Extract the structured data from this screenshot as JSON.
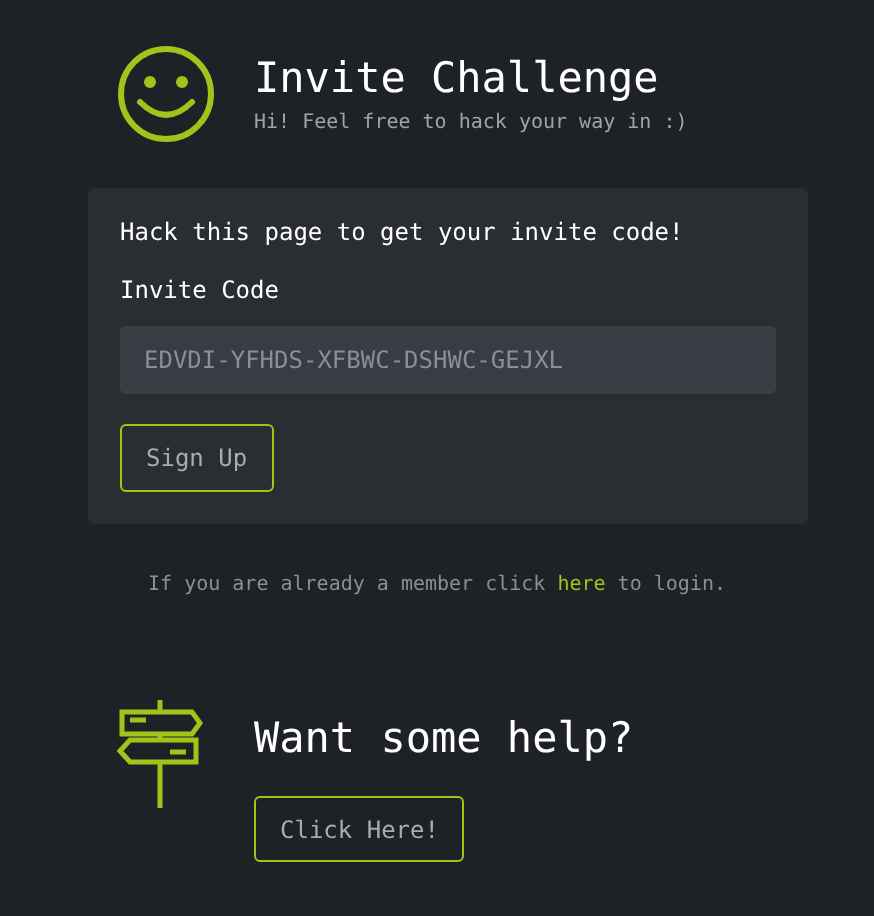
{
  "header": {
    "title": "Invite Challenge",
    "subtitle": "Hi! Feel free to hack your way in :)"
  },
  "card": {
    "heading": "Hack this page to get your invite code!",
    "field_label": "Invite Code",
    "field": {
      "placeholder": "EDVDI-YFHDS-XFBWC-DSHWC-GEJXL"
    },
    "button": "Sign Up"
  },
  "login_note": {
    "before": "If you are already a member click",
    "link": "here",
    "after": "to login."
  },
  "help": {
    "title": "Want some help?",
    "button": "Click Here!"
  }
}
